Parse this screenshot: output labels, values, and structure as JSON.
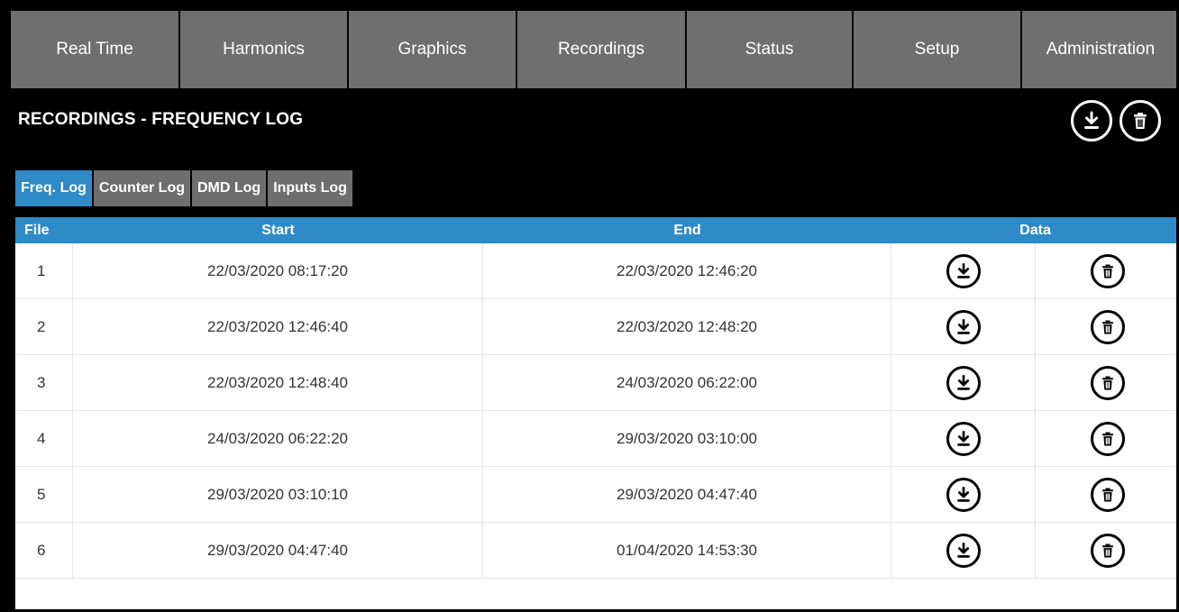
{
  "nav": {
    "items": [
      "Real Time",
      "Harmonics",
      "Graphics",
      "Recordings",
      "Status",
      "Setup",
      "Administration"
    ]
  },
  "page": {
    "title": "RECORDINGS - FREQUENCY LOG"
  },
  "subtabs": [
    "Freq. Log",
    "Counter Log",
    "DMD Log",
    "Inputs Log"
  ],
  "table": {
    "headers": {
      "file": "File",
      "start": "Start",
      "end": "End",
      "data": "Data"
    },
    "rows": [
      {
        "file": "1",
        "start": "22/03/2020 08:17:20",
        "end": "22/03/2020 12:46:20"
      },
      {
        "file": "2",
        "start": "22/03/2020 12:46:40",
        "end": "22/03/2020 12:48:20"
      },
      {
        "file": "3",
        "start": "22/03/2020 12:48:40",
        "end": "24/03/2020 06:22:00"
      },
      {
        "file": "4",
        "start": "24/03/2020 06:22:20",
        "end": "29/03/2020 03:10:00"
      },
      {
        "file": "5",
        "start": "29/03/2020 03:10:10",
        "end": "29/03/2020 04:47:40"
      },
      {
        "file": "6",
        "start": "29/03/2020 04:47:40",
        "end": "01/04/2020 14:53:30"
      }
    ]
  },
  "colors": {
    "accent": "#2f8ac8",
    "nav_bg": "#6f6f6f",
    "background": "#000000"
  },
  "icons": {
    "download": "download-icon",
    "delete": "trash-icon"
  }
}
